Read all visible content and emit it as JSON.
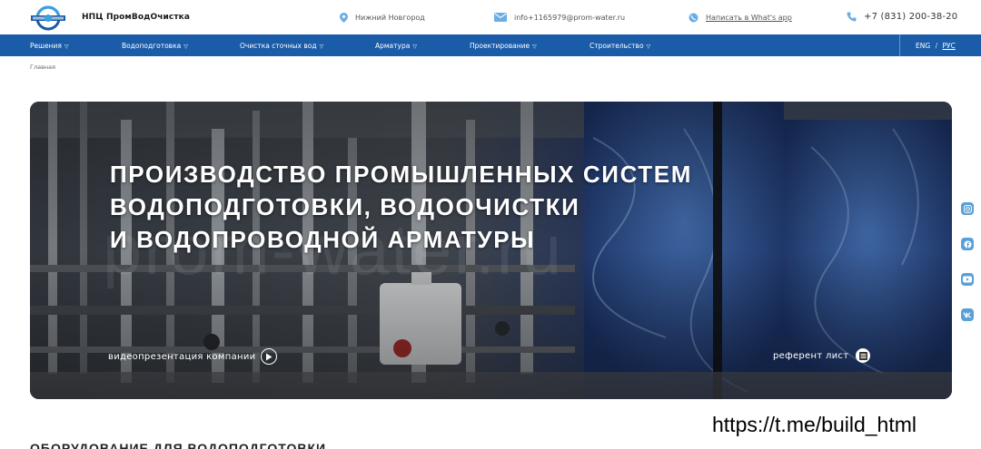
{
  "header": {
    "logo_icon": "prom-vod-ochistka-logo",
    "brand": "НПЦ ПромВодОчистка",
    "city": "Нижний Новгород",
    "email": "info+1165979@prom-water.ru",
    "whatsapp": "Написать в What's app",
    "phone": "+7 (831) 200-38-20"
  },
  "nav": {
    "items": [
      {
        "label": "Решения"
      },
      {
        "label": "Водоподготовка"
      },
      {
        "label": "Очистка сточных вод"
      },
      {
        "label": "Арматура"
      },
      {
        "label": "Проектирование"
      },
      {
        "label": "Строительство"
      }
    ],
    "lang_eng": "ENG",
    "lang_sep": "/",
    "lang_rus": "РУС"
  },
  "breadcrumb": "Главная",
  "hero": {
    "title_line1": "ПРОИЗВОДСТВО ПРОМЫШЛЕННЫХ СИСТЕМ",
    "title_line2": "ВОДОПОДГОТОВКИ, ВОДООЧИСТКИ",
    "title_line3": "И ВОДОПРОВОДНОЙ АРМАТУРЫ",
    "watermark": "prom-water.ru",
    "video_link": "видеопрезентация компании",
    "ref_link": "референт лист"
  },
  "section": {
    "title": "ОБОРУДОВАНИЕ ДЛЯ ВОДОПОДГОТОВКИ"
  },
  "overlay": {
    "telegram": "https://t.me/build_html"
  },
  "social_icons": [
    "instagram-icon",
    "facebook-icon",
    "youtube-icon",
    "vk-icon"
  ],
  "colors": {
    "nav_bg": "#1a5ca8",
    "icon_blue": "#5aa0d8",
    "accent": "#1a5ca8"
  }
}
